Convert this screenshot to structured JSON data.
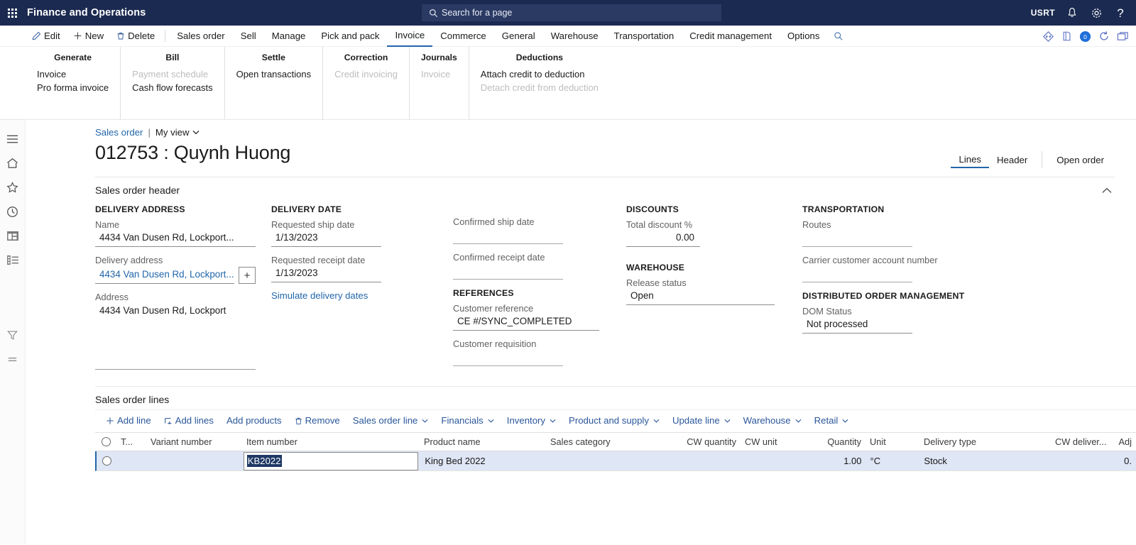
{
  "topbar": {
    "waffle_icon": "app-launcher-icon",
    "app_title": "Finance and Operations",
    "search_placeholder": "Search for a page",
    "search_icon": "search-icon",
    "company": "USRT",
    "notifications_icon": "bell-icon",
    "settings_icon": "gear-icon",
    "help_icon": "question-mark-icon"
  },
  "menubar": {
    "actions": [
      {
        "label": "Edit",
        "icon": "pencil-icon"
      },
      {
        "label": "New",
        "icon": "plus-icon"
      },
      {
        "label": "Delete",
        "icon": "trash-icon"
      }
    ],
    "tabs": [
      {
        "label": "Sales order",
        "active": false
      },
      {
        "label": "Sell",
        "active": false
      },
      {
        "label": "Manage",
        "active": false
      },
      {
        "label": "Pick and pack",
        "active": false
      },
      {
        "label": "Invoice",
        "active": true
      },
      {
        "label": "Commerce",
        "active": false
      },
      {
        "label": "General",
        "active": false
      },
      {
        "label": "Warehouse",
        "active": false
      },
      {
        "label": "Transportation",
        "active": false
      },
      {
        "label": "Credit management",
        "active": false
      },
      {
        "label": "Options",
        "active": false
      }
    ],
    "search_icon": "search-icon",
    "right_icons": [
      "share-icon",
      "open-in-new-window-icon",
      "attachments-icon",
      "refresh-icon",
      "collapse-icon"
    ],
    "attachment_badge": "0"
  },
  "ribbon": {
    "groups": [
      {
        "title": "Generate",
        "items": [
          {
            "label": "Invoice",
            "disabled": false
          },
          {
            "label": "Pro forma invoice",
            "disabled": false
          }
        ]
      },
      {
        "title": "Bill",
        "items": [
          {
            "label": "Payment schedule",
            "disabled": true
          },
          {
            "label": "Cash flow forecasts",
            "disabled": false
          }
        ]
      },
      {
        "title": "Settle",
        "items": [
          {
            "label": "Open transactions",
            "disabled": false
          }
        ]
      },
      {
        "title": "Correction",
        "items": [
          {
            "label": "Credit invoicing",
            "disabled": true
          }
        ]
      },
      {
        "title": "Journals",
        "items": [
          {
            "label": "Invoice",
            "disabled": true
          }
        ]
      },
      {
        "title": "Deductions",
        "items": [
          {
            "label": "Attach credit to deduction",
            "disabled": false
          },
          {
            "label": "Detach credit from deduction",
            "disabled": true
          }
        ]
      }
    ]
  },
  "leftrail": {
    "items": [
      "hamburger-menu-icon",
      "home-icon",
      "favorites-star-icon",
      "recent-clock-icon",
      "workspaces-icon",
      "modules-list-icon"
    ],
    "filter_icon": "filter-icon",
    "equals-icon": "equals-icon"
  },
  "page": {
    "breadcrumb_link": "Sales order",
    "breadcrumb_sep": "|",
    "view_name": "My view",
    "view_caret_icon": "chevron-down-icon",
    "title": "012753 : Quynh Huong",
    "tabs": [
      {
        "label": "Lines",
        "active": true
      },
      {
        "label": "Header",
        "active": false
      }
    ],
    "open_order_label": "Open order"
  },
  "header_panel": {
    "title": "Sales order header",
    "collapse_icon": "chevron-up-icon",
    "delivery_address": {
      "group_title": "DELIVERY ADDRESS",
      "name_label": "Name",
      "name_value": "4434 Van Dusen Rd, Lockport...",
      "delivery_address_label": "Delivery address",
      "delivery_address_value": "4434 Van Dusen Rd, Lockport...",
      "add_button_icon": "plus-icon",
      "address_label": "Address",
      "address_value": "4434 Van Dusen Rd, Lockport"
    },
    "delivery_date": {
      "group_title": "DELIVERY DATE",
      "requested_ship_date_label": "Requested ship date",
      "requested_ship_date_value": "1/13/2023",
      "requested_receipt_date_label": "Requested receipt date",
      "requested_receipt_date_value": "1/13/2023",
      "simulate_link": "Simulate delivery dates"
    },
    "dates_confirm": {
      "confirmed_ship_date_label": "Confirmed ship date",
      "confirmed_ship_date_value": "",
      "confirmed_receipt_date_label": "Confirmed receipt date",
      "confirmed_receipt_date_value": ""
    },
    "references": {
      "group_title": "REFERENCES",
      "customer_reference_label": "Customer reference",
      "customer_reference_value": "CE  #/SYNC_COMPLETED",
      "customer_requisition_label": "Customer requisition",
      "customer_requisition_value": ""
    },
    "discounts": {
      "group_title": "DISCOUNTS",
      "total_discount_label": "Total discount %",
      "total_discount_value": "0.00"
    },
    "warehouse": {
      "group_title": "WAREHOUSE",
      "release_status_label": "Release status",
      "release_status_value": "Open"
    },
    "transportation": {
      "group_title": "TRANSPORTATION",
      "routes_label": "Routes",
      "routes_value": "",
      "carrier_label": "Carrier customer account number",
      "carrier_value": ""
    },
    "dom": {
      "group_title": "DISTRIBUTED ORDER MANAGEMENT",
      "dom_status_label": "DOM Status",
      "dom_status_value": "Not processed"
    }
  },
  "lines_panel": {
    "title": "Sales order lines",
    "toolbar": [
      {
        "label": "Add line",
        "icon": "plus-icon",
        "caret": false
      },
      {
        "label": "Add lines",
        "icon": "add-lines-icon",
        "caret": false
      },
      {
        "label": "Add products",
        "icon": "",
        "caret": false
      },
      {
        "label": "Remove",
        "icon": "trash-icon",
        "caret": false
      },
      {
        "label": "Sales order line",
        "icon": "",
        "caret": true
      },
      {
        "label": "Financials",
        "icon": "",
        "caret": true
      },
      {
        "label": "Inventory",
        "icon": "",
        "caret": true
      },
      {
        "label": "Product and supply",
        "icon": "",
        "caret": true
      },
      {
        "label": "Update line",
        "icon": "",
        "caret": true
      },
      {
        "label": "Warehouse",
        "icon": "",
        "caret": true
      },
      {
        "label": "Retail",
        "icon": "",
        "caret": true
      }
    ],
    "columns": [
      "T...",
      "Variant number",
      "Item number",
      "Product name",
      "Sales category",
      "CW quantity",
      "CW unit",
      "Quantity",
      "Unit",
      "Delivery type",
      "CW deliver...",
      "Adj"
    ],
    "rows": [
      {
        "select_icon": "radio-unselected-icon",
        "type": "",
        "variant_number": "",
        "item_number": "KB2022",
        "item_number_editing": true,
        "product_name": "King Bed 2022",
        "sales_category": "",
        "cw_quantity": "",
        "cw_unit": "",
        "quantity": "1.00",
        "unit": "°C",
        "delivery_type": "Stock",
        "cw_deliver": "",
        "adj": "0."
      }
    ]
  },
  "colors": {
    "navbar": "#1b2a50",
    "accent": "#2266aa",
    "link": "#2b579a",
    "selected_row": "#dfe6f5",
    "text_selection": "#1f3864"
  }
}
